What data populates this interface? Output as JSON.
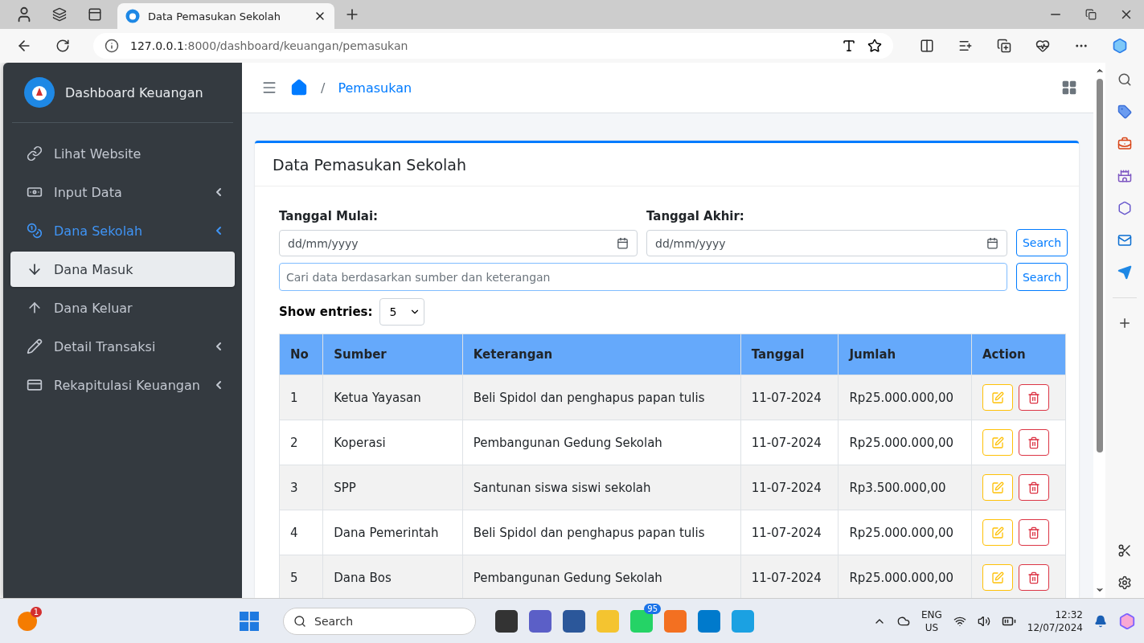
{
  "browser": {
    "tab_title": "Data Pemasukan Sekolah",
    "url_host": "127.0.0.1",
    "url_rest": ":8000/dashboard/keuangan/pemasukan"
  },
  "sidebar": {
    "brand": "Dashboard Keuangan",
    "items": [
      {
        "label": "Lihat Website",
        "selected": false
      },
      {
        "label": "Input Data",
        "selected": false,
        "expanded": false
      },
      {
        "label": "Dana Sekolah",
        "selected": false,
        "expanded": true,
        "children": [
          {
            "label": "Dana Masuk",
            "selected": true
          },
          {
            "label": "Dana Keluar",
            "selected": false
          }
        ]
      },
      {
        "label": "Detail Transaksi",
        "selected": false,
        "expanded": false
      },
      {
        "label": "Rekapitulasi Keuangan",
        "selected": false,
        "expanded": false
      }
    ]
  },
  "breadcrumb_separator": "/",
  "breadcrumb": "Pemasukan",
  "card": {
    "title": "Data Pemasukan Sekolah",
    "filters": {
      "start_label": "Tanggal Mulai:",
      "start_placeholder": "dd/mm/yyyy",
      "end_label": "Tanggal Akhir:",
      "end_placeholder": "dd/mm/yyyy",
      "date_button": "Search",
      "search_placeholder": "Cari data berdasarkan sumber dan keterangan",
      "search_button": "Search"
    },
    "entries": {
      "label": "Show entries:",
      "value": "5"
    },
    "table": {
      "columns": [
        "No",
        "Sumber",
        "Keterangan",
        "Tanggal",
        "Jumlah",
        "Action"
      ],
      "rows": [
        [
          "1",
          "Ketua Yayasan",
          "Beli Spidol dan penghapus papan tulis",
          "11-07-2024",
          "Rp25.000.000,00"
        ],
        [
          "2",
          "Koperasi",
          "Pembangunan Gedung Sekolah",
          "11-07-2024",
          "Rp25.000.000,00"
        ],
        [
          "3",
          "SPP",
          "Santunan siswa siswi sekolah",
          "11-07-2024",
          "Rp3.500.000,00"
        ],
        [
          "4",
          "Dana Pemerintah",
          "Beli Spidol dan penghapus papan tulis",
          "11-07-2024",
          "Rp25.000.000,00"
        ],
        [
          "5",
          "Dana Bos",
          "Pembangunan Gedung Sekolah",
          "11-07-2024",
          "Rp25.000.000,00"
        ]
      ]
    }
  },
  "taskbar": {
    "notification_count": "1",
    "search_placeholder": "Search",
    "whatsapp_badge": "95",
    "language": "ENG",
    "region": "US",
    "time": "12:32",
    "date": "12/07/2024"
  }
}
